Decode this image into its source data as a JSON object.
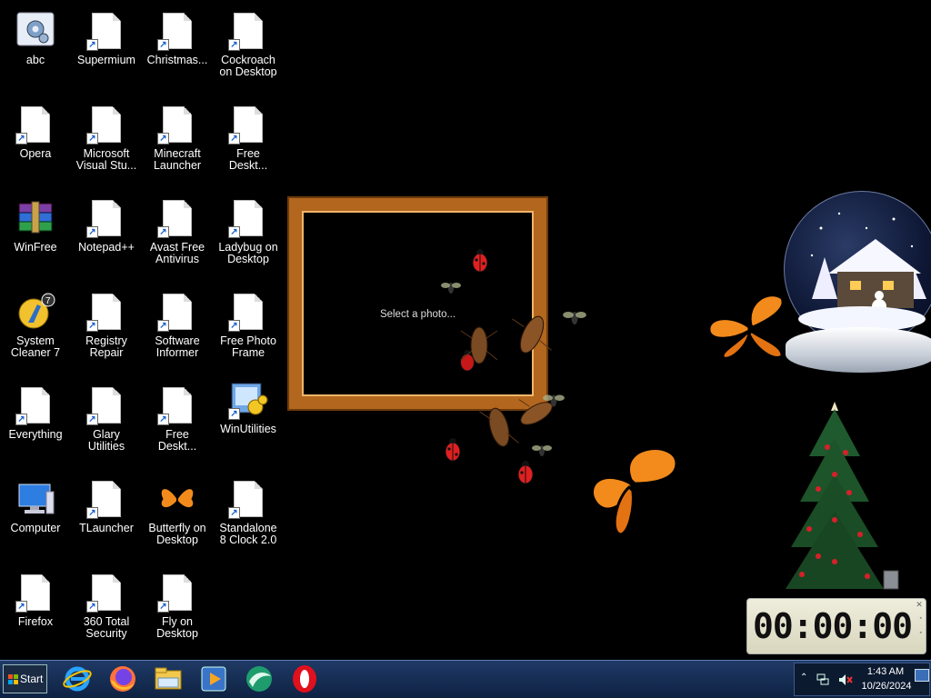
{
  "desktop": {
    "icons": [
      {
        "label": "abc"
      },
      {
        "label": "Supermium"
      },
      {
        "label": "Christmas..."
      },
      {
        "label": "Cockroach\non Desktop"
      },
      {
        "label": "Opera"
      },
      {
        "label": "Microsoft\nVisual Stu..."
      },
      {
        "label": "Minecraft\nLauncher"
      },
      {
        "label": "Free\nDeskt..."
      },
      {
        "label": "WinFree"
      },
      {
        "label": "Notepad++"
      },
      {
        "label": "Avast Free\nAntivirus"
      },
      {
        "label": "Ladybug on\nDesktop"
      },
      {
        "label": "System\nCleaner 7"
      },
      {
        "label": "Registry\nRepair"
      },
      {
        "label": "Software\nInformer"
      },
      {
        "label": "Free Photo\nFrame"
      },
      {
        "label": "Everything"
      },
      {
        "label": "Glary\nUtilities"
      },
      {
        "label": "Free\nDeskt..."
      },
      {
        "label": "WinUtilities"
      },
      {
        "label": "Computer"
      },
      {
        "label": "TLauncher"
      },
      {
        "label": "Butterfly on\nDesktop"
      },
      {
        "label": "Standalone\n8 Clock 2.0"
      },
      {
        "label": "Firefox"
      },
      {
        "label": "360 Total\nSecurity"
      },
      {
        "label": "Fly on\nDesktop"
      }
    ]
  },
  "photo_frame": {
    "prompt": "Select a photo..."
  },
  "clock_widget": {
    "time": "00:00:00"
  },
  "taskbar": {
    "start_label": "Start",
    "pinned": [
      {
        "icon": "internet-explorer-icon"
      },
      {
        "icon": "firefox-icon"
      },
      {
        "icon": "file-explorer-icon"
      },
      {
        "icon": "media-player-icon"
      },
      {
        "icon": "browser-globe-icon"
      },
      {
        "icon": "opera-icon"
      }
    ],
    "tray": {
      "time": "1:43 AM",
      "date": "10/26/2024"
    }
  },
  "colors": {
    "taskbar": "#1f3a66",
    "frame_wood": "#b2661e",
    "butterfly": "#f28a1c",
    "ladybug": "#e02020"
  }
}
